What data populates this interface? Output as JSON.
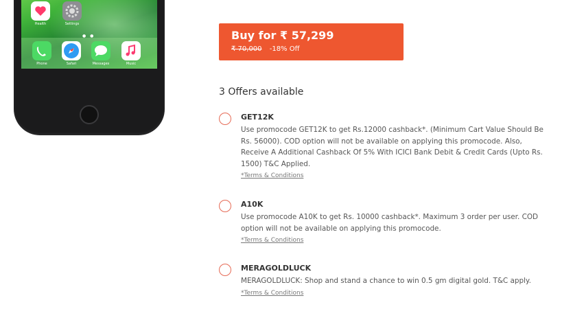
{
  "phone": {
    "top_apps": [
      {
        "icon": "heart-icon",
        "label": "Health"
      },
      {
        "icon": "gear-icon",
        "label": "Settings"
      }
    ],
    "dock_apps": [
      {
        "icon": "phone-icon",
        "label": "Phone"
      },
      {
        "icon": "compass-icon",
        "label": "Safari"
      },
      {
        "icon": "chat-bubble-icon",
        "label": "Messages"
      },
      {
        "icon": "music-note-icon",
        "label": "Music"
      }
    ],
    "page_dots": "● ●"
  },
  "buy": {
    "label": "Buy for ₹ 57,299",
    "mrp": "₹ 70,000",
    "discount": "-18% Off"
  },
  "offers": {
    "heading": "3 Offers available",
    "items": [
      {
        "code": "GET12K",
        "description": "Use promocode GET12K to get Rs.12000 cashback*. (Minimum Cart Value Should Be Rs. 56000). COD option will not be available on applying this promocode. Also, Receive A Additional Cashback Of 5% With ICICI Bank Debit & Credit Cards (Upto Rs. 1500) T&C Applied.",
        "terms": "*Terms & Conditions"
      },
      {
        "code": "A10K",
        "description": "Use promocode A10K to get Rs. 10000 cashback*. Maximum 3 order per user. COD option will not be available on applying this promocode.",
        "terms": "*Terms & Conditions"
      },
      {
        "code": "MERAGOLDLUCK",
        "description": "MERAGOLDLUCK: Shop and stand a chance to win 0.5 gm digital gold. T&C apply.",
        "terms": "*Terms & Conditions"
      }
    ]
  },
  "colors": {
    "accent": "#ee5730",
    "radio_border": "#e66a55"
  }
}
